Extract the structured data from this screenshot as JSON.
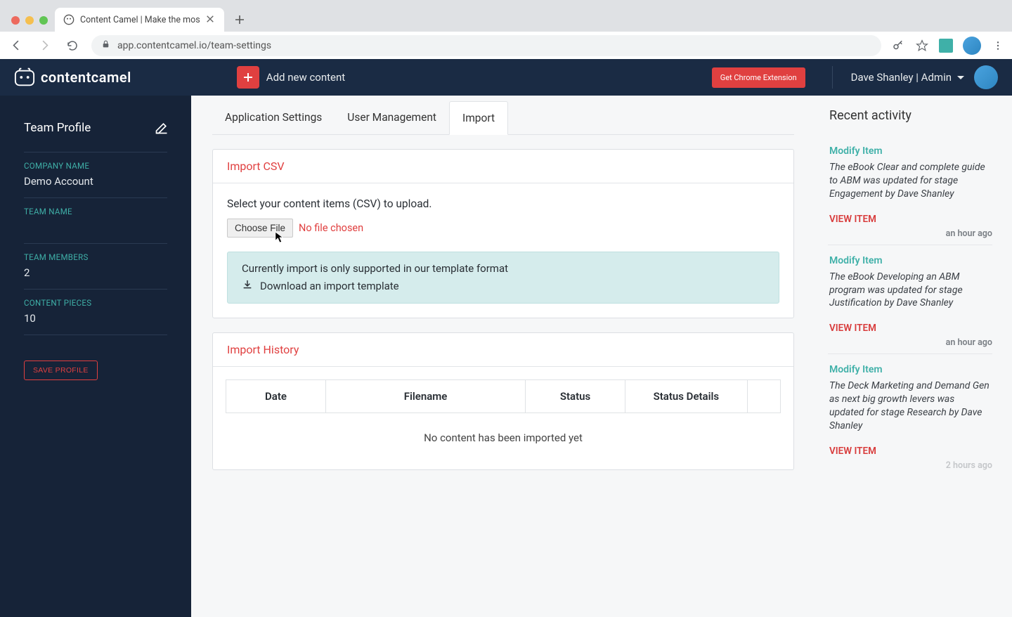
{
  "browser": {
    "tab_title": "Content Camel | Make the mos",
    "url": "app.contentcamel.io/team-settings"
  },
  "header": {
    "logo_text": "contentcamel",
    "add_content_label": "Add new content",
    "chrome_ext_label": "Get Chrome Extension",
    "user_label": "Dave Shanley | Admin"
  },
  "sidebar": {
    "title": "Team Profile",
    "fields": [
      {
        "label": "COMPANY NAME",
        "value": "Demo Account"
      },
      {
        "label": "TEAM NAME",
        "value": ""
      },
      {
        "label": "TEAM MEMBERS",
        "value": "2"
      },
      {
        "label": "CONTENT PIECES",
        "value": "10"
      }
    ],
    "save_label": "SAVE PROFILE"
  },
  "tabs": [
    {
      "label": "Application Settings",
      "active": false
    },
    {
      "label": "User Management",
      "active": false
    },
    {
      "label": "Import",
      "active": true
    }
  ],
  "import_csv": {
    "title": "Import CSV",
    "instruction": "Select your content items (CSV) to upload.",
    "choose_file_label": "Choose File",
    "no_file_label": "No file chosen",
    "info_text": "Currently import is only supported in our template format",
    "download_label": "Download an import template"
  },
  "import_history": {
    "title": "Import History",
    "columns": [
      "Date",
      "Filename",
      "Status",
      "Status Details"
    ],
    "empty_text": "No content has been imported yet"
  },
  "activity": {
    "title": "Recent activity",
    "items": [
      {
        "title": "Modify Item",
        "body": "The eBook Clear and complete guide to ABM was updated for stage Engagement by Dave Shanley",
        "link": "VIEW ITEM",
        "time": "an hour ago"
      },
      {
        "title": "Modify Item",
        "body": "The eBook Developing an ABM program was updated for stage Justification by Dave Shanley",
        "link": "VIEW ITEM",
        "time": "an hour ago"
      },
      {
        "title": "Modify Item",
        "body": "The Deck Marketing and Demand Gen as next big growth levers was updated for stage Research by Dave Shanley",
        "link": "VIEW ITEM",
        "time": "2 hours ago"
      }
    ]
  }
}
